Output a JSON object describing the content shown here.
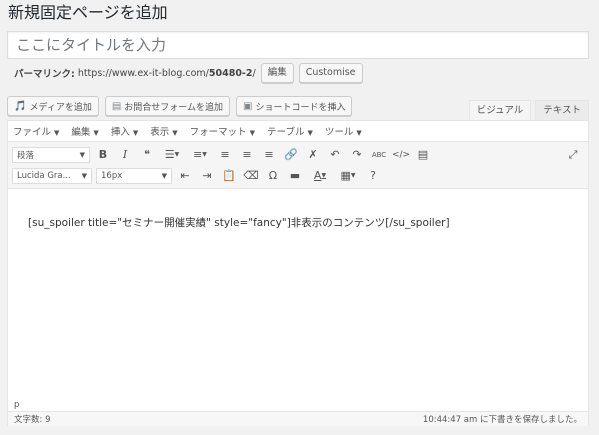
{
  "page": {
    "heading": "新規固定ページを追加"
  },
  "title": {
    "placeholder": "ここにタイトルを入力"
  },
  "permalink": {
    "label": "パーマリンク:",
    "base": "https://www.ex-it-blog.com/",
    "slug": "50480-2",
    "suffix": "/",
    "edit_label": "編集",
    "customise_label": "Customise"
  },
  "media_buttons": [
    {
      "icon": "media-icon",
      "label": "メディアを追加"
    },
    {
      "icon": "form-icon",
      "label": "お問合せフォームを追加"
    },
    {
      "icon": "shortcode-icon",
      "label": "ショートコードを挿入"
    }
  ],
  "editor_tabs": {
    "visual": "ビジュアル",
    "text": "テキスト"
  },
  "menubar": {
    "file": "ファイル",
    "edit": "編集",
    "insert": "挿入",
    "view": "表示",
    "format": "フォーマット",
    "table": "テーブル",
    "tools": "ツール"
  },
  "toolbar": {
    "format_select": "段落",
    "font_select": "Lucida Gra...",
    "size_select": "16px",
    "bold": "B",
    "italic": "I",
    "quote": "❝",
    "omega": "Ω",
    "help": "?"
  },
  "content": {
    "text": "[su_spoiler title=\"セミナー開催実績\" style=\"fancy\"]非表示のコンテンツ[/su_spoiler]"
  },
  "status": {
    "path": "p",
    "word_count": "文字数: 9",
    "saved": "10:44:47 am に下書きを保存しました。"
  }
}
